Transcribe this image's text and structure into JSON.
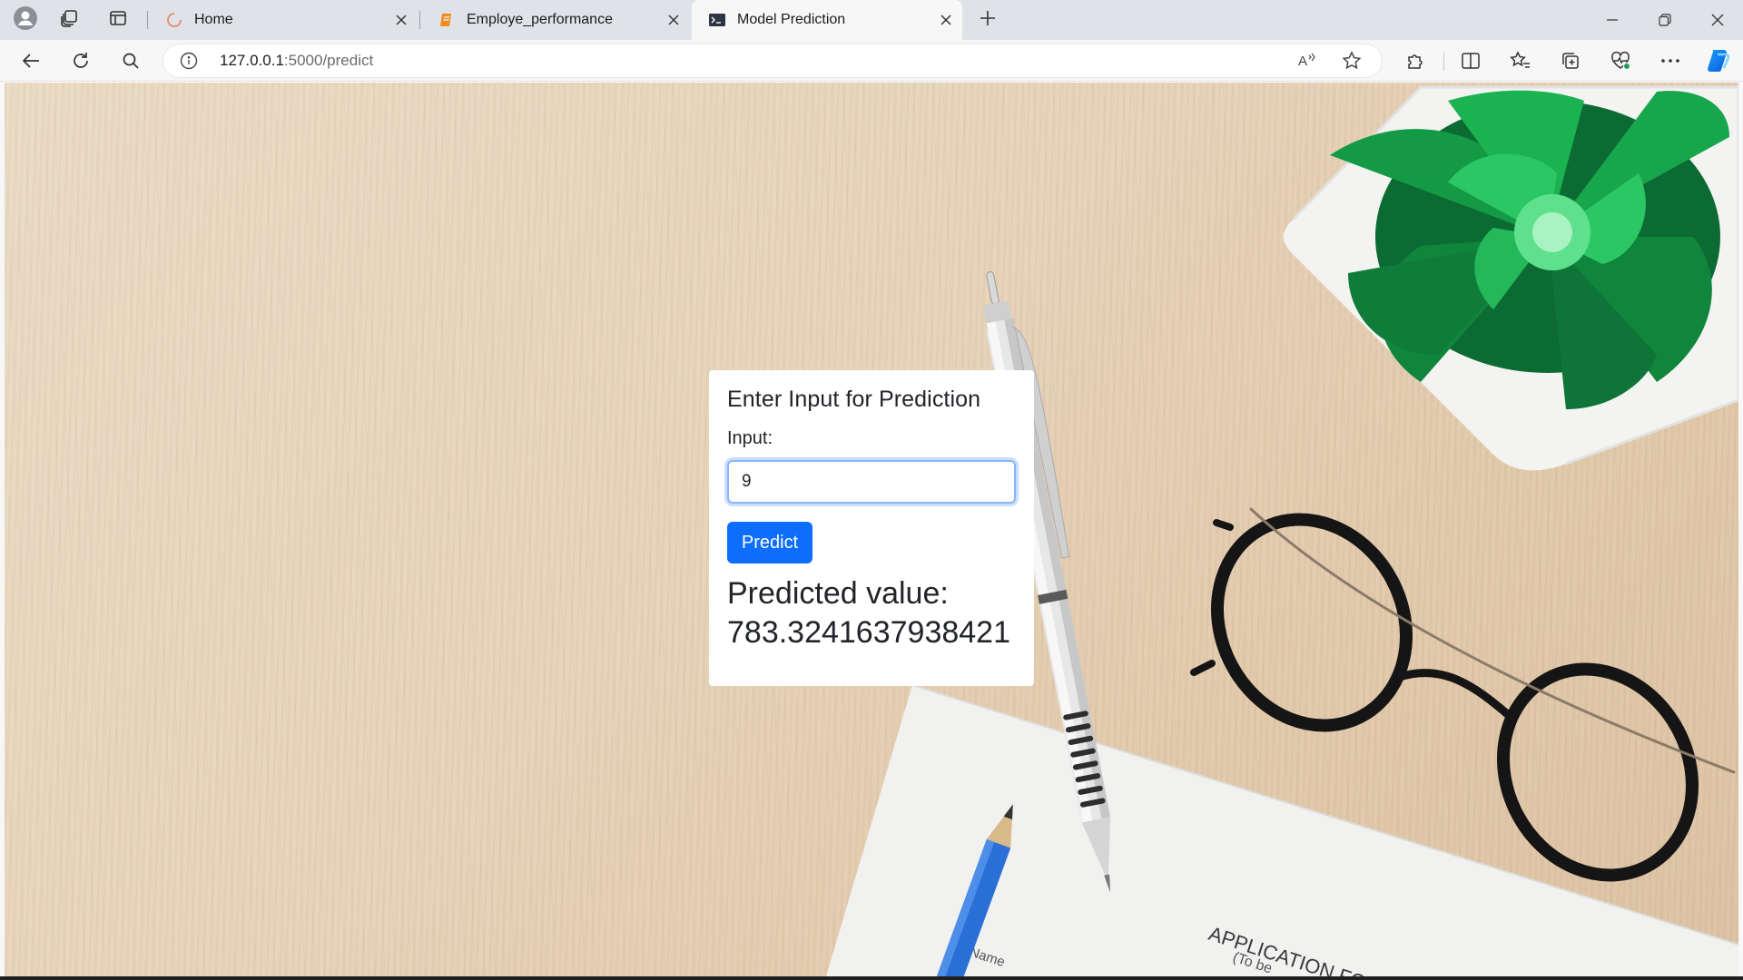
{
  "browser": {
    "tabs": [
      {
        "title": "Home",
        "active": false,
        "icon": "loading-spinner-icon"
      },
      {
        "title": "Employe_performance",
        "active": false,
        "icon": "notebook-icon"
      },
      {
        "title": "Model Prediction",
        "active": true,
        "icon": "terminal-icon"
      }
    ],
    "address": {
      "host": "127.0.0.1",
      "path": ":5000/predict"
    }
  },
  "page": {
    "heading": "Enter Input for Prediction",
    "input_label": "Input:",
    "input_value": "9",
    "button_label": "Predict",
    "result_label": "Predicted value:",
    "result_value": "783.3241637938421"
  },
  "background": {
    "paper_text_1": "APPLICATION FO",
    "paper_text_2": "(To be",
    "paper_text_3": "Name"
  },
  "colors": {
    "accent": "#0d6efd",
    "tab_strip": "#dfe3e8",
    "toolbar": "#f7f7f7",
    "desk": "#e6d2b8",
    "plant": "#1fa84a"
  }
}
